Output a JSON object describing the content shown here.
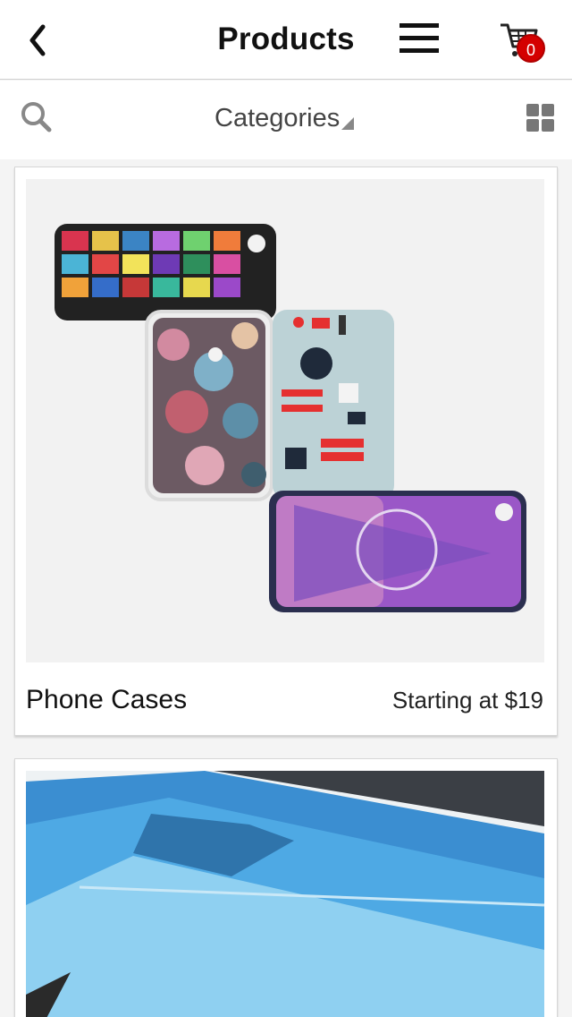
{
  "header": {
    "title": "Products",
    "back_icon": "chevron-left-icon",
    "menu_icon": "hamburger-menu-icon",
    "cart_icon": "shopping-cart-icon",
    "cart_count": "0"
  },
  "toolbar": {
    "search_icon": "search-icon",
    "categories_label": "Categories",
    "grid_icon": "grid-view-icon"
  },
  "products": [
    {
      "name": "Phone Cases",
      "price": "Starting at $19"
    },
    {
      "name": "",
      "price": ""
    }
  ],
  "colors": {
    "badge": "#d40000",
    "header_bg": "#ffffff",
    "page_bg": "#f4f4f4"
  }
}
